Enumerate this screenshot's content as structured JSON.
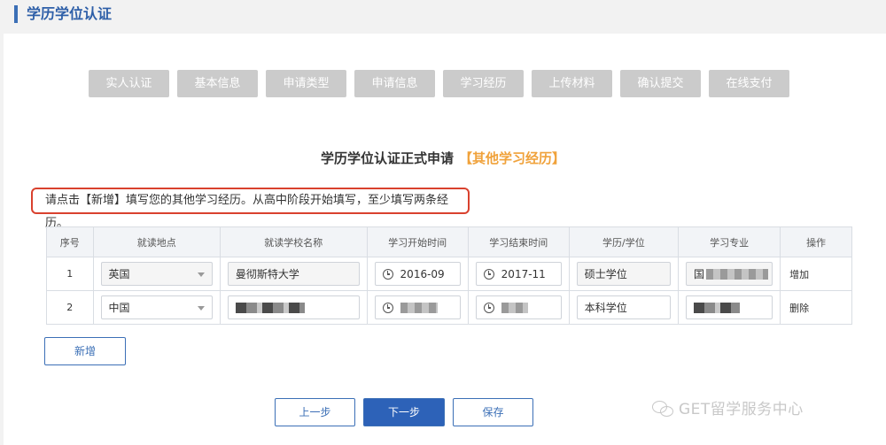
{
  "header": {
    "title": "学历学位认证"
  },
  "steps": [
    "实人认证",
    "基本信息",
    "申请类型",
    "申请信息",
    "学习经历",
    "上传材料",
    "确认提交",
    "在线支付"
  ],
  "form": {
    "title": "学历学位认证正式申请",
    "subtitle": "【其他学习经历】",
    "notice": "请点击【新增】填写您的其他学习经历。从高中阶段开始填写，至少填写两条经历。"
  },
  "table": {
    "headers": [
      "序号",
      "就读地点",
      "就读学校名称",
      "学习开始时间",
      "学习结束时间",
      "学历/学位",
      "学习专业",
      "操作"
    ],
    "rows": [
      {
        "index": "1",
        "location": "英国",
        "school": "曼彻斯特大学",
        "start": "2016-09",
        "end": "2017-11",
        "degree": "硕士学位",
        "major_prefix": "国",
        "action": "增加"
      },
      {
        "index": "2",
        "location": "中国",
        "school": "",
        "start": "",
        "end": "",
        "degree": "本科学位",
        "major_prefix": "",
        "action": "删除"
      }
    ]
  },
  "buttons": {
    "add": "新增",
    "prev": "上一步",
    "next": "下一步",
    "save": "保存"
  },
  "watermark": "GET留学服务中心",
  "colors": {
    "accent": "#2d62b8",
    "notice_border": "#d9412e",
    "subtitle": "#f0a23b",
    "step_bg": "#cbcbcb"
  }
}
